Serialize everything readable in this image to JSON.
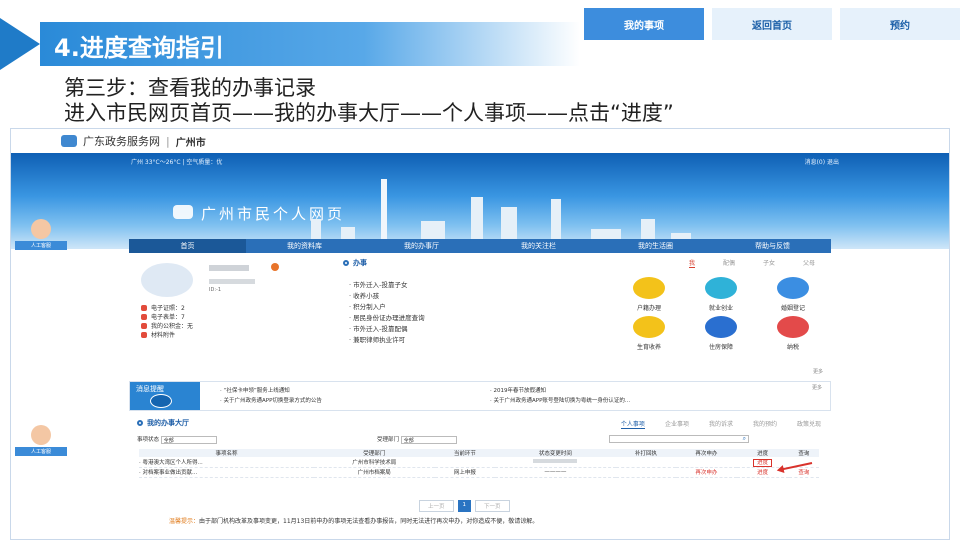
{
  "slide": {
    "title": "4.进度查询指引",
    "nav": [
      "我的事项",
      "返回首页",
      "预约"
    ],
    "step_line1": "第三步：查看我的办事记录",
    "step_line2": "进入市民网页首页——我的办事大厅——个人事项——点击“进度”"
  },
  "site": {
    "name": "广东政务服务网",
    "city": "广州市",
    "topline": "广州  33°C～26°C  |  空气质量：优",
    "user_links": "消息(0)  退出",
    "portal_title": "广州市民个人网页",
    "cs_label": "人工客服"
  },
  "main_nav": [
    "首页",
    "我的资料库",
    "我的办事厅",
    "我的关注栏",
    "我的生活圈",
    "帮助与反馈"
  ],
  "profile": {
    "acct_suffix": "ID:-1",
    "stats": [
      "电子证照：2",
      "电子表单：7",
      "我的公积金：无",
      "材料附件"
    ]
  },
  "services": {
    "title": "办事",
    "subtabs": [
      "我",
      "配偶",
      "子女",
      "父母"
    ],
    "items": [
      "市外迁入-投靠子女",
      "收养小孩",
      "积分制入户",
      "居民身份证办理进度查询",
      "市外迁入-投靠配偶",
      "兼职律师执业许可"
    ],
    "icons": [
      {
        "label": "户籍办理",
        "color": "#f3c21a"
      },
      {
        "label": "就业创业",
        "color": "#2fb2d8"
      },
      {
        "label": "婚姻登记",
        "color": "#3b8ee2"
      },
      {
        "label": "生育收养",
        "color": "#f3c21a"
      },
      {
        "label": "住房保障",
        "color": "#2a6fd0"
      },
      {
        "label": "纳税",
        "color": "#e34a4a"
      }
    ],
    "more": "更多"
  },
  "notice": {
    "label": "消息提醒",
    "items": [
      "“社保卡申领”服务上线通知",
      "2019年春节放假通知",
      "关于广州政务通APP切换登录方式的公告",
      "关于广州政务通APP账号登陆切换为粤统一身份认证的..."
    ],
    "more": "更多"
  },
  "hall": {
    "title": "我的办事大厅",
    "tabs": [
      "个人事项",
      "企业事项",
      "我的诉求",
      "我的预约",
      "政策兑现"
    ],
    "status_label": "事项状态",
    "status_value": "全部",
    "dept_label": "受理部门",
    "dept_value": "全部",
    "columns": [
      "事项名称",
      "受理部门",
      "当前环节",
      "状态变更时间",
      "补打回执",
      "再次申办",
      "进度",
      "查询"
    ],
    "rows": [
      [
        "粤港澳大湾区个人所得...",
        "广州市科学技术局",
        "",
        "",
        "",
        "",
        "进度",
        ""
      ],
      [
        "对档案事业做出贡献...",
        "广州市档案局",
        "网上申报",
        "————",
        "",
        "再次申办",
        "进度",
        "查询"
      ]
    ],
    "pager": [
      "上一页",
      "1",
      "下一页"
    ],
    "hint_label": "温馨提示：",
    "hint_text": "由于部门机构改革及事项变更，11月13日前申办的事项无法查看办事报告，同时无法进行再次申办，对你造成不便，敬请谅解。"
  }
}
